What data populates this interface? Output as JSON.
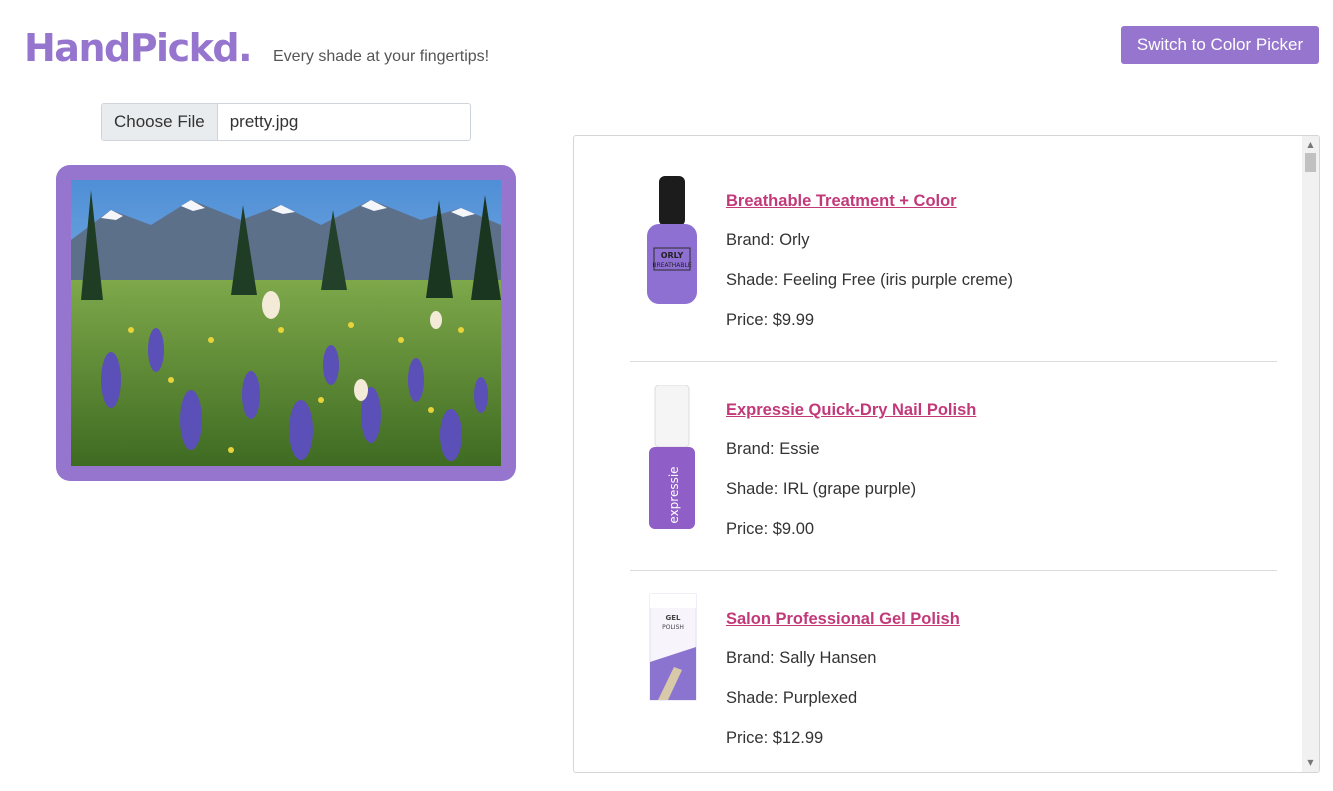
{
  "header": {
    "logo": "HandPickd.",
    "tagline": "Every shade at your fingertips!",
    "switch_label": "Switch to Color Picker"
  },
  "upload": {
    "button_label": "Choose File",
    "file_name": "pretty.jpg"
  },
  "colors": {
    "accent": "#9575cd",
    "link": "#c2397a"
  },
  "products": [
    {
      "title": "Breathable Treatment + Color",
      "brand": "Brand: Orly",
      "shade": "Shade: Feeling Free (iris purple creme)",
      "price": "Price: $9.99",
      "bottle_text": "ORLY BREATHABLE"
    },
    {
      "title": "Expressie Quick-Dry Nail Polish",
      "brand": "Brand: Essie",
      "shade": "Shade: IRL (grape purple)",
      "price": "Price: $9.00",
      "bottle_text": "expressie"
    },
    {
      "title": "Salon Professional Gel Polish",
      "brand": "Brand: Sally Hansen",
      "shade": "Shade: Purplexed",
      "price": "Price: $12.99",
      "bottle_text": "GEL POLISH"
    }
  ]
}
